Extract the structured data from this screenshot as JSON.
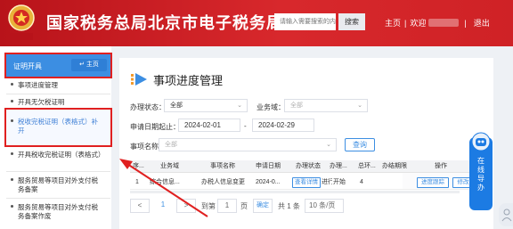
{
  "header": {
    "title": "国家税务总局北京市电子税务局",
    "emblem_text": "中国税务",
    "search_placeholder": "请输入需要搜索的内容",
    "search_button": "搜索",
    "home_link": "主页",
    "welcome": "欢迎",
    "logout": "退出"
  },
  "sidebar": {
    "heading": "证明开具",
    "home_button": "主页",
    "items": [
      {
        "label": "事项进度管理"
      },
      {
        "label": "开具无欠税证明"
      },
      {
        "label": "税收完税证明（表格式）补开"
      },
      {
        "label": "开具税收完税证明（表格式）"
      },
      {
        "label": "服务贸易等项目对外支付税务备案"
      },
      {
        "label": "服务贸易等项目对外支付税务备案作废"
      }
    ]
  },
  "main": {
    "title": "事项进度管理",
    "filters": {
      "status_label": "办理状态：",
      "status_value": "全部",
      "domain_label": "业务域：",
      "domain_placeholder": "全部",
      "date_label": "申请日期起止：",
      "date_start": "2024-02-01",
      "date_sep": "-",
      "date_end": "2024-02-29",
      "item_label": "事项名称：",
      "item_placeholder": "全部",
      "query_button": "查询"
    },
    "table": {
      "headers": [
        "序...",
        "业务域",
        "事项名称",
        "申请日期",
        "办理状态",
        "办理...",
        "总环...",
        "办结期限",
        "操作"
      ],
      "rows": [
        {
          "no": "1",
          "domain": "综合信息...",
          "item": "办税人信息变更",
          "date": "2024-0...",
          "status_button": "查看详情",
          "node": "进行中",
          "step": "开始",
          "total": "4",
          "deadline": "",
          "ops": [
            "进度跟踪",
            "修改",
            "撤回"
          ]
        }
      ]
    },
    "pager": {
      "prev": "<",
      "current": "1",
      "next": ">",
      "goto_label": "到第",
      "goto_value": "1",
      "page_unit": "页",
      "confirm": "确定",
      "total": "共 1 条",
      "page_size": "10 条/页"
    }
  },
  "float_help": {
    "label": "在线导办"
  },
  "colors": {
    "header_red": "#cf2226",
    "accent_blue": "#3c8ee2",
    "highlight_red": "#e02020"
  }
}
